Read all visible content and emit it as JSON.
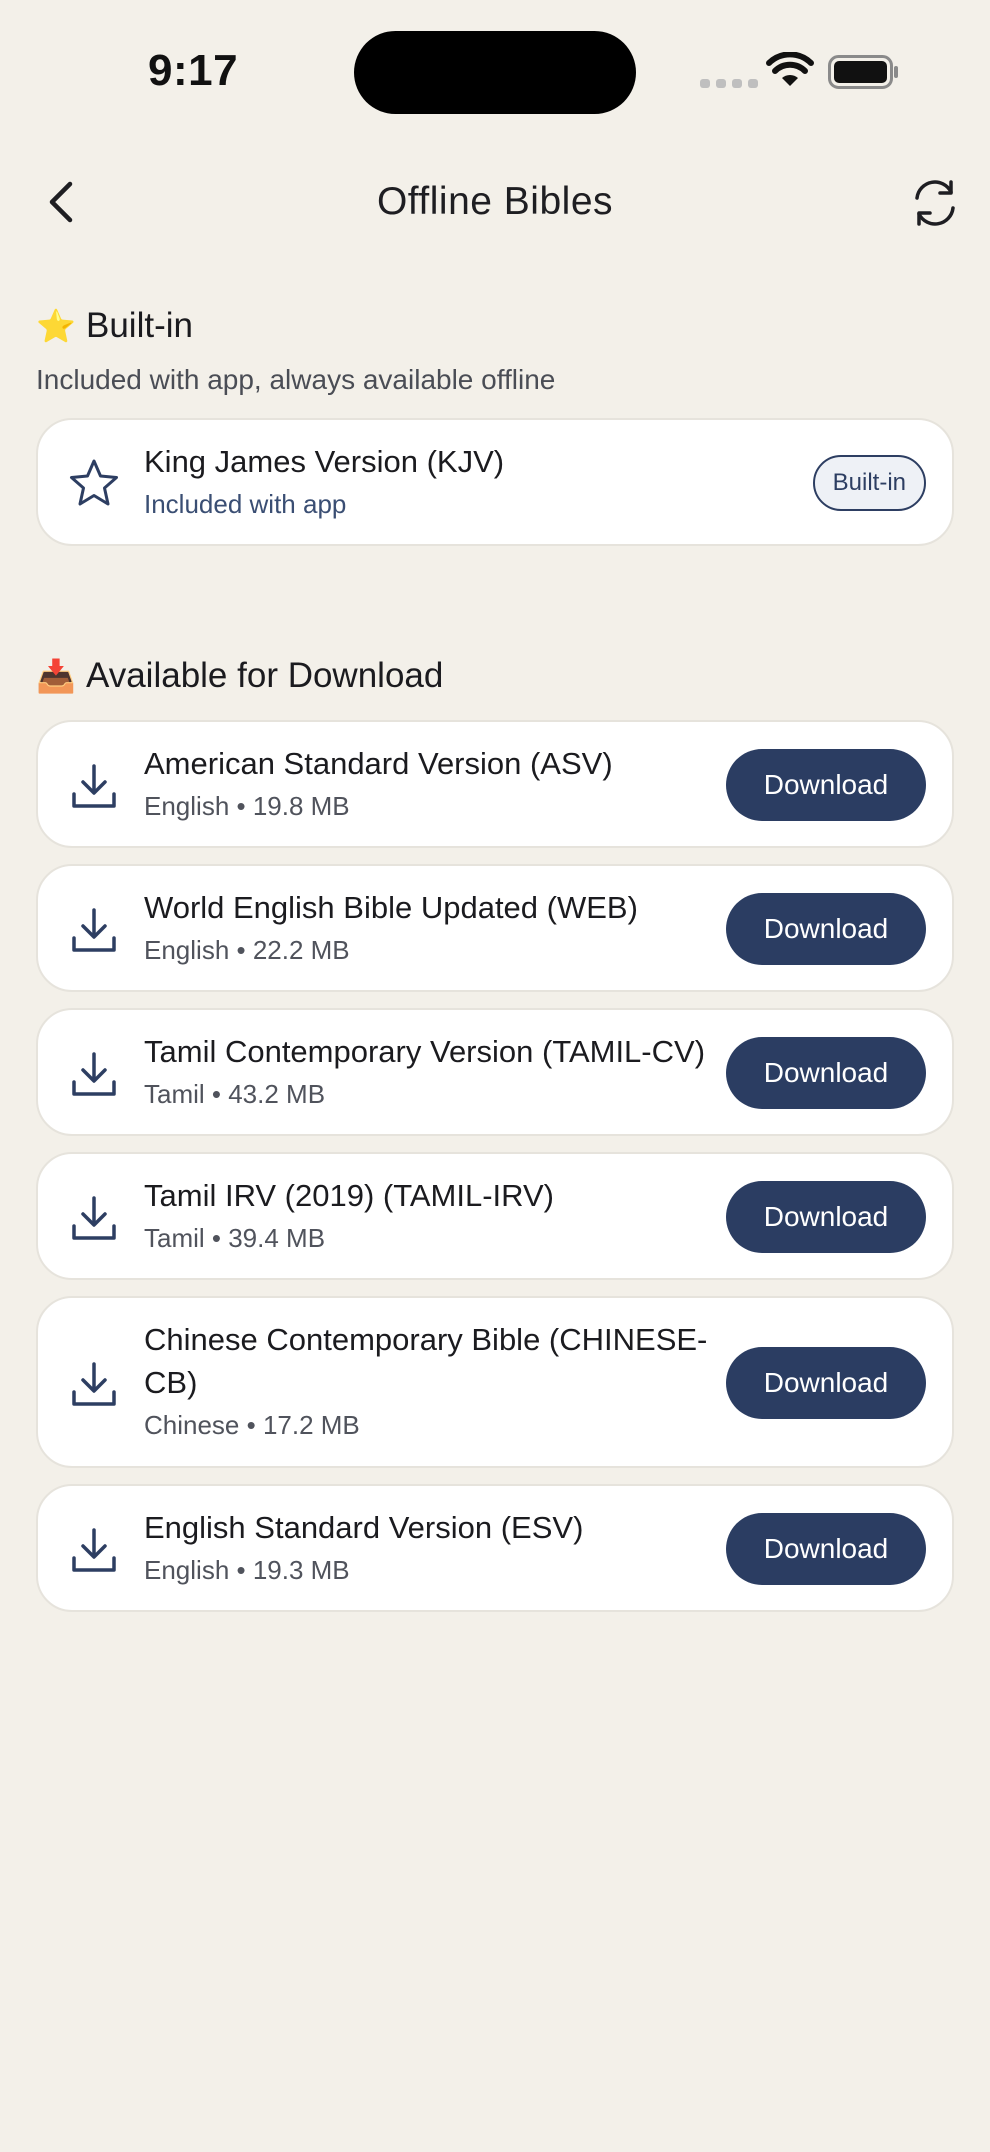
{
  "status_bar": {
    "time": "9:17"
  },
  "header": {
    "title": "Offline Bibles"
  },
  "builtin_section": {
    "emoji": "⭐",
    "title": "Built-in",
    "subtitle": "Included with app, always available offline",
    "items": [
      {
        "title": "King James Version (KJV)",
        "meta": "Included with app",
        "badge": "Built-in"
      }
    ]
  },
  "download_section": {
    "emoji": "📥",
    "title": "Available for Download",
    "items": [
      {
        "title": "American Standard Version (ASV)",
        "meta": "English • 19.8 MB",
        "button": "Download"
      },
      {
        "title": "World English Bible Updated (WEB)",
        "meta": "English • 22.2 MB",
        "button": "Download"
      },
      {
        "title": "Tamil Contemporary Version (TAMIL-CV)",
        "meta": "Tamil • 43.2 MB",
        "button": "Download"
      },
      {
        "title": "Tamil IRV (2019) (TAMIL-IRV)",
        "meta": "Tamil • 39.4 MB",
        "button": "Download"
      },
      {
        "title": "Chinese Contemporary Bible (CHINESE-CB)",
        "meta": "Chinese • 17.2 MB",
        "button": "Download"
      },
      {
        "title": "English Standard Version (ESV)",
        "meta": "English • 19.3 MB",
        "button": "Download"
      }
    ]
  },
  "icons": {
    "back": "chevron-left-icon",
    "refresh": "refresh-icon",
    "builtin_item": "star-icon",
    "download_item": "download-icon"
  },
  "colors": {
    "background": "#F3F0E9",
    "accent": "#2B3D62",
    "card": "#FFFFFF"
  }
}
